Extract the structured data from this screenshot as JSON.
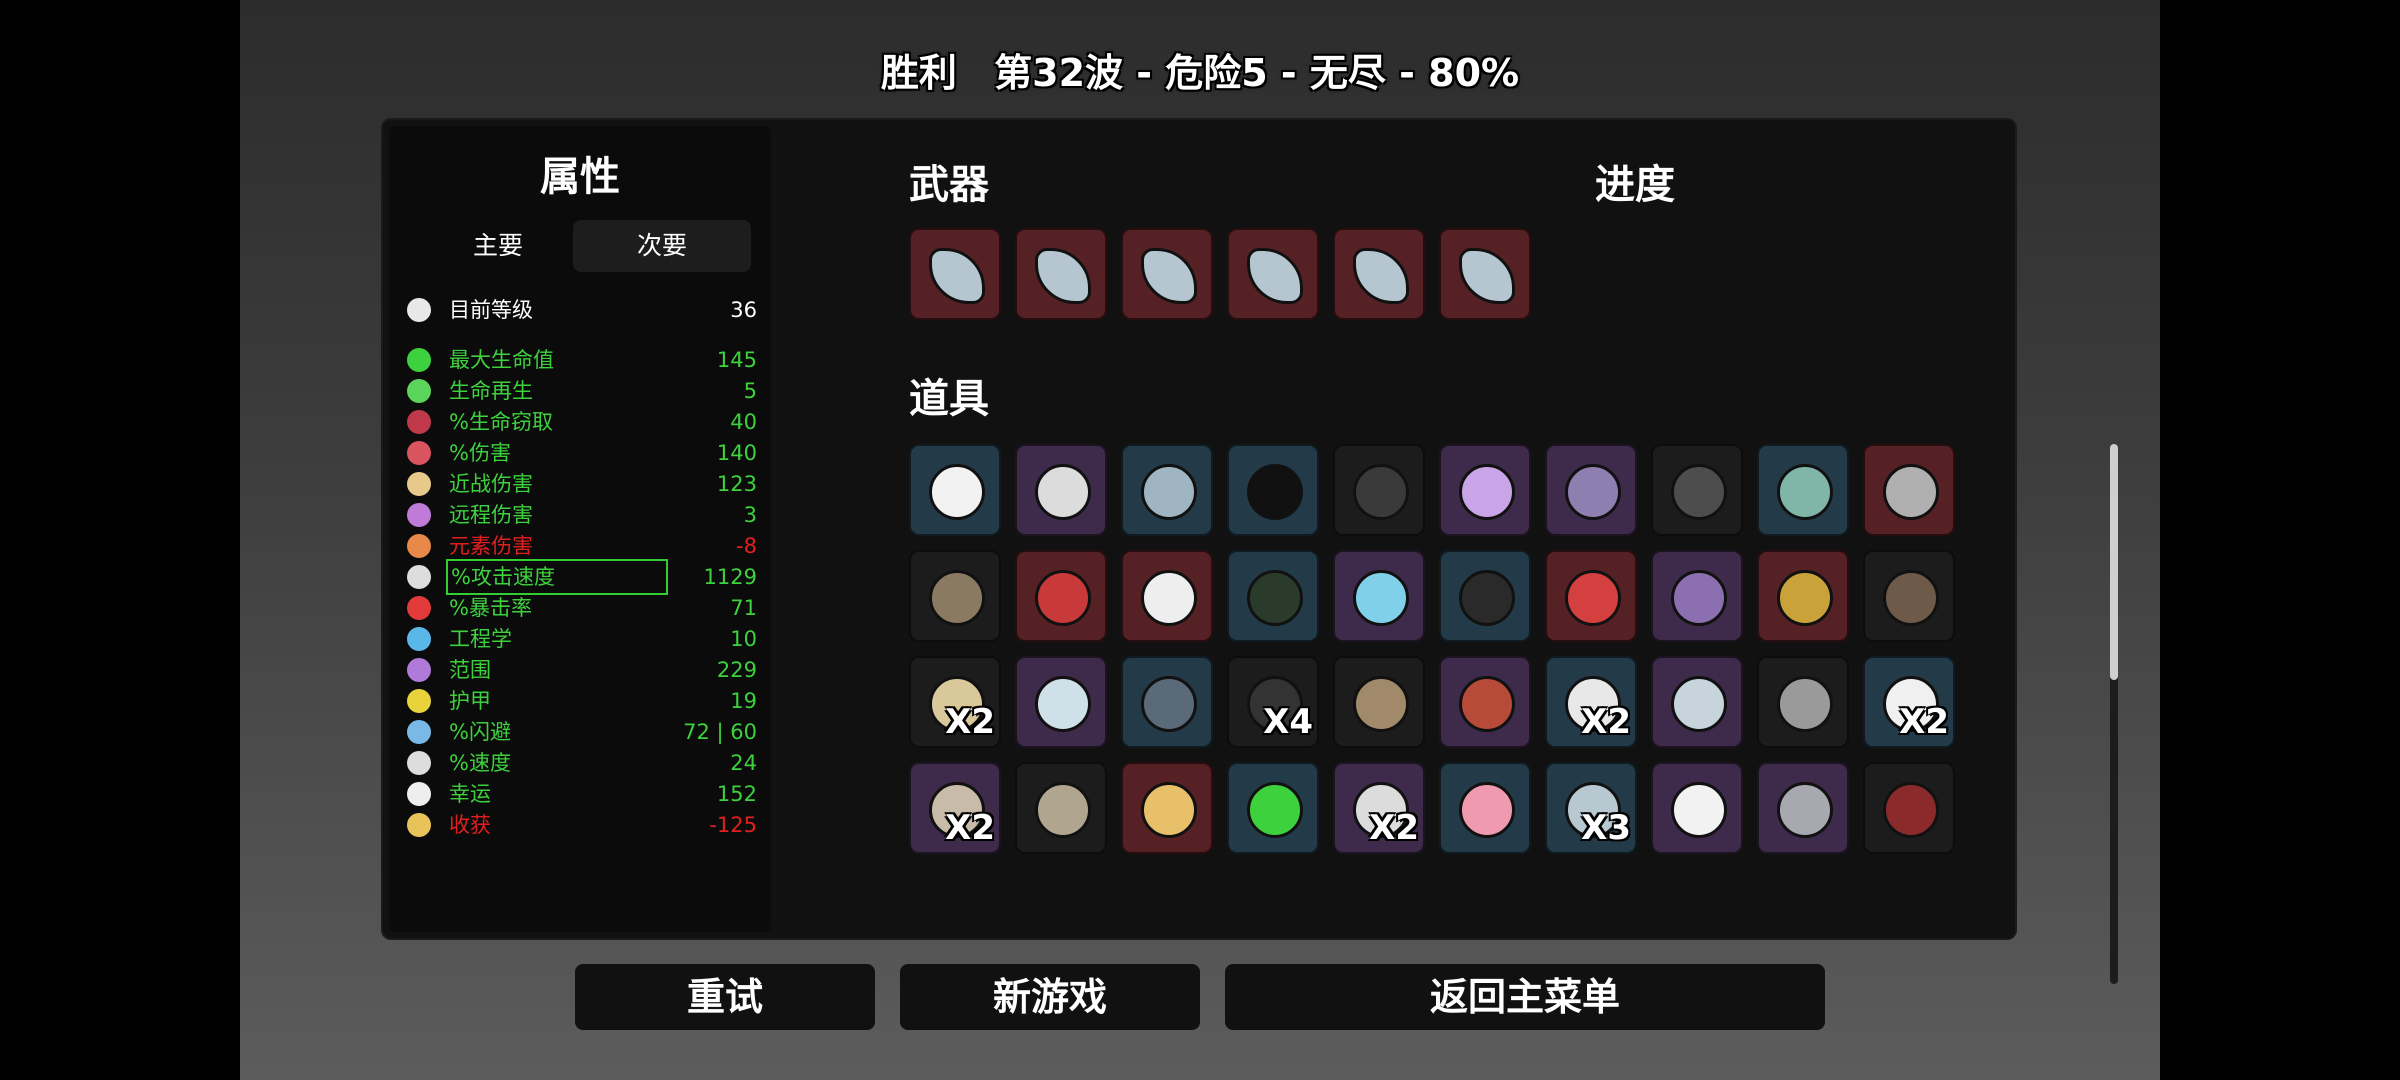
{
  "header": {
    "result": "胜利",
    "run_info": "第32波 - 危险5 - 无尽 - 80%"
  },
  "stats": {
    "title": "属性",
    "tabs": {
      "primary": "主要",
      "secondary": "次要",
      "active": "secondary"
    },
    "level": {
      "label": "目前等级",
      "value": "36",
      "icon": "level-icon"
    },
    "rows": [
      {
        "label": "最大生命值",
        "value": "145",
        "color": "#3ed13e",
        "icon": "heart-icon",
        "icon_color": "#3ed13e"
      },
      {
        "label": "生命再生",
        "value": "5",
        "color": "#3ed13e",
        "icon": "regen-icon",
        "icon_color": "#5ad45a"
      },
      {
        "label": "%生命窃取",
        "value": "40",
        "color": "#3ed13e",
        "icon": "lifesteal-icon",
        "icon_color": "#c0394a"
      },
      {
        "label": "%伤害",
        "value": "140",
        "color": "#3ed13e",
        "icon": "damage-icon",
        "icon_color": "#d9545f"
      },
      {
        "label": "近战伤害",
        "value": "123",
        "color": "#3ed13e",
        "icon": "melee-icon",
        "icon_color": "#e8c98a"
      },
      {
        "label": "远程伤害",
        "value": "3",
        "color": "#3ed13e",
        "icon": "ranged-icon",
        "icon_color": "#c07ad8"
      },
      {
        "label": "元素伤害",
        "value": "-8",
        "color": "#e02020",
        "icon": "elemental-icon",
        "icon_color": "#e8894a"
      },
      {
        "label": "%攻击速度",
        "value": "1129",
        "color": "#3ed13e",
        "icon": "hourglass-icon",
        "icon_color": "#dddddd",
        "highlighted": true
      },
      {
        "label": "%暴击率",
        "value": "71",
        "color": "#3ed13e",
        "icon": "crit-icon",
        "icon_color": "#e03a3a"
      },
      {
        "label": "工程学",
        "value": "10",
        "color": "#3ed13e",
        "icon": "engineering-icon",
        "icon_color": "#5ab8e8"
      },
      {
        "label": "范围",
        "value": "229",
        "color": "#3ed13e",
        "icon": "range-icon",
        "icon_color": "#b07ad8"
      },
      {
        "label": "护甲",
        "value": "19",
        "color": "#3ed13e",
        "icon": "armor-icon",
        "icon_color": "#e8d43a"
      },
      {
        "label": "%闪避",
        "value": "72 | 60",
        "color": "#3ed13e",
        "icon": "dodge-icon",
        "icon_color": "#7ab8e8"
      },
      {
        "label": "%速度",
        "value": "24",
        "color": "#3ed13e",
        "icon": "speed-icon",
        "icon_color": "#dddddd"
      },
      {
        "label": "幸运",
        "value": "152",
        "color": "#3ed13e",
        "icon": "luck-icon",
        "icon_color": "#eeeeee"
      },
      {
        "label": "收获",
        "value": "-125",
        "color": "#e02020",
        "icon": "harvest-icon",
        "icon_color": "#e8c35a"
      }
    ]
  },
  "weapons": {
    "title": "武器",
    "items": [
      {
        "icon": "crystal-shard-icon",
        "rarity": "red"
      },
      {
        "icon": "crystal-shard-icon",
        "rarity": "red"
      },
      {
        "icon": "crystal-shard-icon",
        "rarity": "red"
      },
      {
        "icon": "crystal-shard-icon",
        "rarity": "red"
      },
      {
        "icon": "crystal-shard-icon",
        "rarity": "red"
      },
      {
        "icon": "crystal-shard-icon",
        "rarity": "red"
      }
    ]
  },
  "progress": {
    "title": "进度"
  },
  "items": {
    "title": "道具",
    "grid": [
      [
        {
          "icon": "screaming-egg-icon",
          "rarity": "blue",
          "count": "",
          "art": "#f2f2f2"
        },
        {
          "icon": "baby-bottle-icon",
          "rarity": "purple",
          "count": "",
          "art": "#dcdcdc"
        },
        {
          "icon": "lamp-icon",
          "rarity": "blue",
          "count": "",
          "art": "#9fb6c2"
        },
        {
          "icon": "sunglasses-icon",
          "rarity": "blue",
          "count": "",
          "art": "#111111"
        },
        {
          "icon": "cloaked-cat-icon",
          "rarity": "black",
          "count": "",
          "art": "#3a3a3a"
        },
        {
          "icon": "potion-lantern-icon",
          "rarity": "purple",
          "count": "",
          "art": "#c9a4e6"
        },
        {
          "icon": "baby-alien-icon",
          "rarity": "purple",
          "count": "",
          "art": "#8f7fb0"
        },
        {
          "icon": "dark-tree-icon",
          "rarity": "black",
          "count": "",
          "art": "#4d4d4d"
        },
        {
          "icon": "flashlight-icon",
          "rarity": "blue",
          "count": "",
          "art": "#7fb6a8"
        },
        {
          "icon": "robot-spider-icon",
          "rarity": "red",
          "count": "",
          "art": "#b0b0b0"
        }
      ],
      [
        {
          "icon": "hook-snail-icon",
          "rarity": "black",
          "count": "",
          "art": "#8a7a62"
        },
        {
          "icon": "red-cape-icon",
          "rarity": "red",
          "count": "",
          "art": "#c83a3a"
        },
        {
          "icon": "sun-clock-icon",
          "rarity": "red",
          "count": "",
          "art": "#eeeeee"
        },
        {
          "icon": "binoculars-icon",
          "rarity": "blue",
          "count": "",
          "art": "#2b3b2b"
        },
        {
          "icon": "triangle-gem-icon",
          "rarity": "purple",
          "count": "",
          "art": "#7fd0e8"
        },
        {
          "icon": "black-cloth-icon",
          "rarity": "blue",
          "count": "",
          "art": "#2a2a2a"
        },
        {
          "icon": "red-hoodie-icon",
          "rarity": "red",
          "count": "",
          "art": "#d44040"
        },
        {
          "icon": "ghost-icon",
          "rarity": "purple",
          "count": "",
          "art": "#8c6fb0"
        },
        {
          "icon": "gold-coin-icon",
          "rarity": "red",
          "count": "",
          "art": "#c9a23a"
        },
        {
          "icon": "hedgehog-icon",
          "rarity": "black",
          "count": "",
          "art": "#6e5a48"
        }
      ],
      [
        {
          "icon": "treasure-map-icon",
          "rarity": "black",
          "count": "X2",
          "art": "#d9c89a"
        },
        {
          "icon": "cannon-icon",
          "rarity": "purple",
          "count": "",
          "art": "#cfe0e8"
        },
        {
          "icon": "rocket-icon",
          "rarity": "blue",
          "count": "",
          "art": "#5a6a78"
        },
        {
          "icon": "coal-icon",
          "rarity": "black",
          "count": "X4",
          "art": "#333333"
        },
        {
          "icon": "mortar-pestle-icon",
          "rarity": "black",
          "count": "",
          "art": "#a08a6a"
        },
        {
          "icon": "lobster-claw-icon",
          "rarity": "purple",
          "count": "",
          "art": "#b84a3a"
        },
        {
          "icon": "worm-icon",
          "rarity": "blue",
          "count": "X2",
          "art": "#e8e8e8"
        },
        {
          "icon": "eraser-icon",
          "rarity": "purple",
          "count": "",
          "art": "#c8d4dc"
        },
        {
          "icon": "helmet-icon",
          "rarity": "black",
          "count": "",
          "art": "#9a9a9a"
        },
        {
          "icon": "white-rabbit-icon",
          "rarity": "blue",
          "count": "X2",
          "art": "#f0f0f0"
        }
      ],
      [
        {
          "icon": "tardigrade-icon",
          "rarity": "purple",
          "count": "X2",
          "art": "#c8bca8"
        },
        {
          "icon": "fleece-ram-icon",
          "rarity": "black",
          "count": "",
          "art": "#b0a690"
        },
        {
          "icon": "bullet-icon",
          "rarity": "red",
          "count": "",
          "art": "#e8c06a"
        },
        {
          "icon": "green-potion-icon",
          "rarity": "blue",
          "count": "",
          "art": "#3ed13e"
        },
        {
          "icon": "rabbit-foot-icon",
          "rarity": "purple",
          "count": "X2",
          "art": "#dcdcdc"
        },
        {
          "icon": "piggy-bank-icon",
          "rarity": "blue",
          "count": "",
          "art": "#f09ab0"
        },
        {
          "icon": "scythe-blade-icon",
          "rarity": "blue",
          "count": "X3",
          "art": "#b8c8d0"
        },
        {
          "icon": "mustache-face-icon",
          "rarity": "purple",
          "count": "",
          "art": "#f2f2f2"
        },
        {
          "icon": "knight-helmet-icon",
          "rarity": "purple",
          "count": "",
          "art": "#a8a8b0"
        },
        {
          "icon": "plaid-shirt-icon",
          "rarity": "black",
          "count": "",
          "art": "#8a2a2a"
        }
      ]
    ]
  },
  "buttons": {
    "retry": "重试",
    "new_game": "新游戏",
    "main_menu": "返回主菜单"
  }
}
